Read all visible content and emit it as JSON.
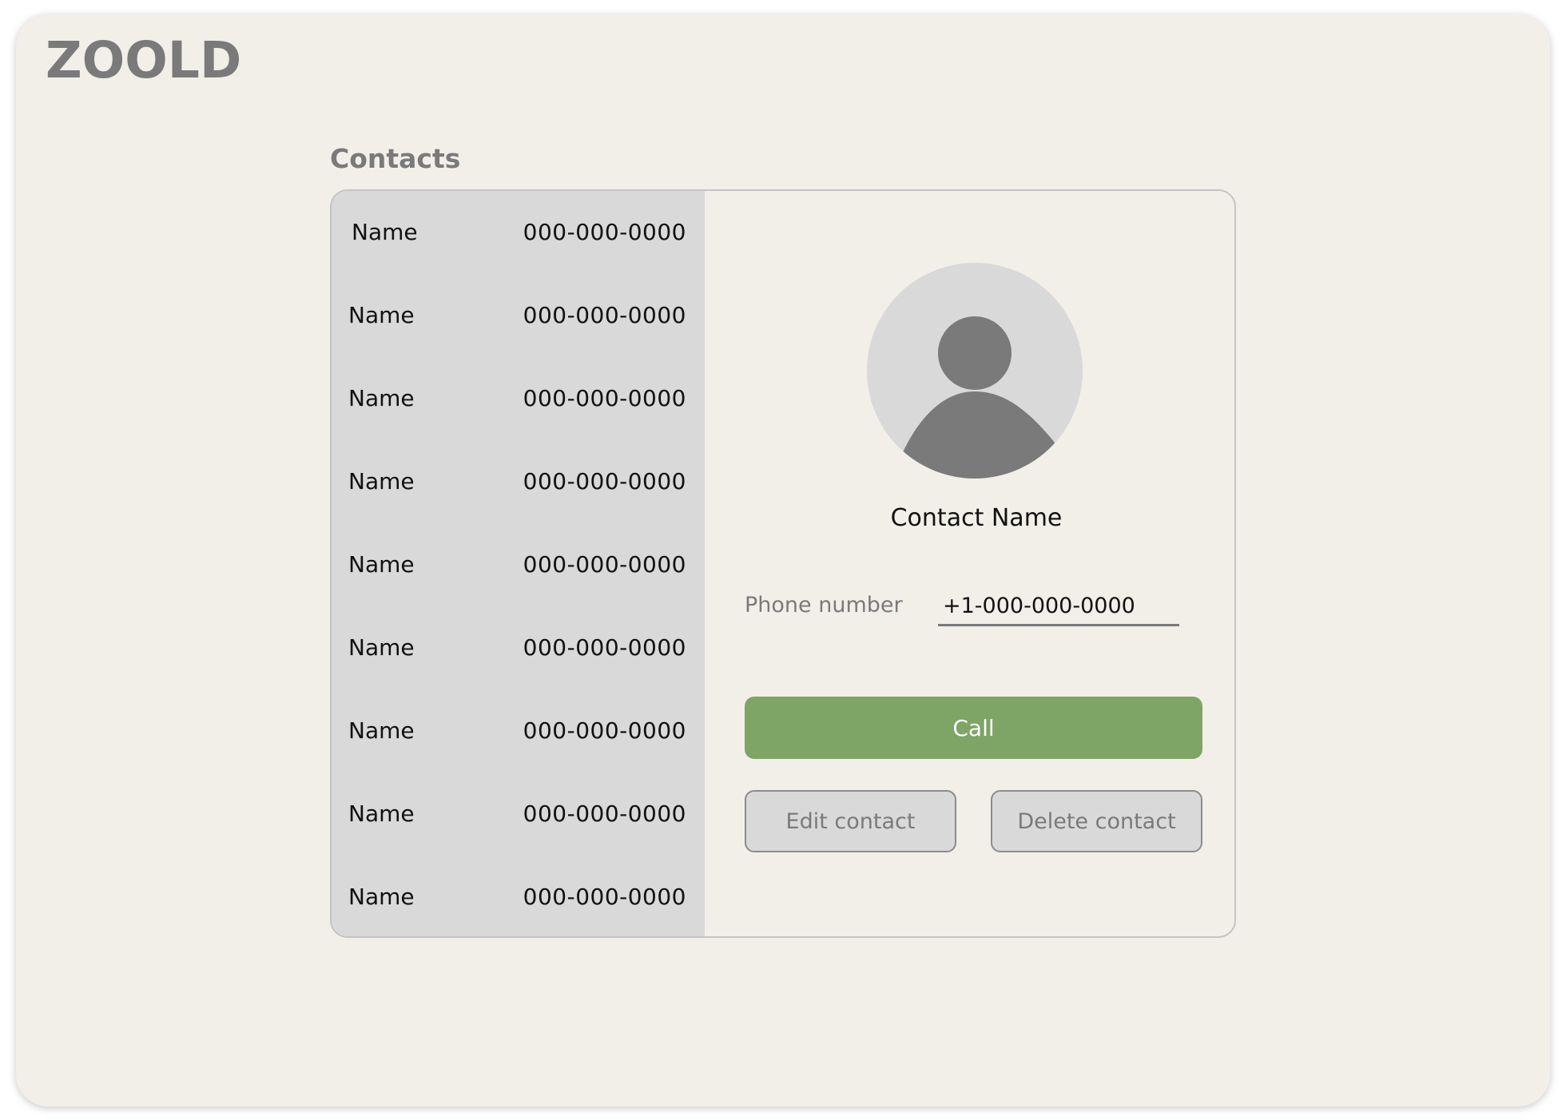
{
  "app": {
    "logo": "ZOOLD"
  },
  "contacts": {
    "title": "Contacts",
    "list": [
      {
        "name": "Name",
        "phone": "000-000-0000"
      },
      {
        "name": "Name",
        "phone": "000-000-0000"
      },
      {
        "name": "Name",
        "phone": "000-000-0000"
      },
      {
        "name": "Name",
        "phone": "000-000-0000"
      },
      {
        "name": "Name",
        "phone": "000-000-0000"
      },
      {
        "name": "Name",
        "phone": "000-000-0000"
      },
      {
        "name": "Name",
        "phone": "000-000-0000"
      },
      {
        "name": "Name",
        "phone": "000-000-0000"
      },
      {
        "name": "Name",
        "phone": "000-000-0000"
      }
    ]
  },
  "detail": {
    "avatar_icon": "user-avatar-icon",
    "contact_name": "Contact Name",
    "phone_label": "Phone number",
    "phone_value": "+1-000-000-0000",
    "call_label": "Call",
    "edit_label": "Edit contact",
    "delete_label": "Delete contact"
  },
  "colors": {
    "background": "#f2efe9",
    "list_background": "#d9d9d9",
    "call_button": "#7ea466",
    "muted_text": "#7a7a7a"
  }
}
